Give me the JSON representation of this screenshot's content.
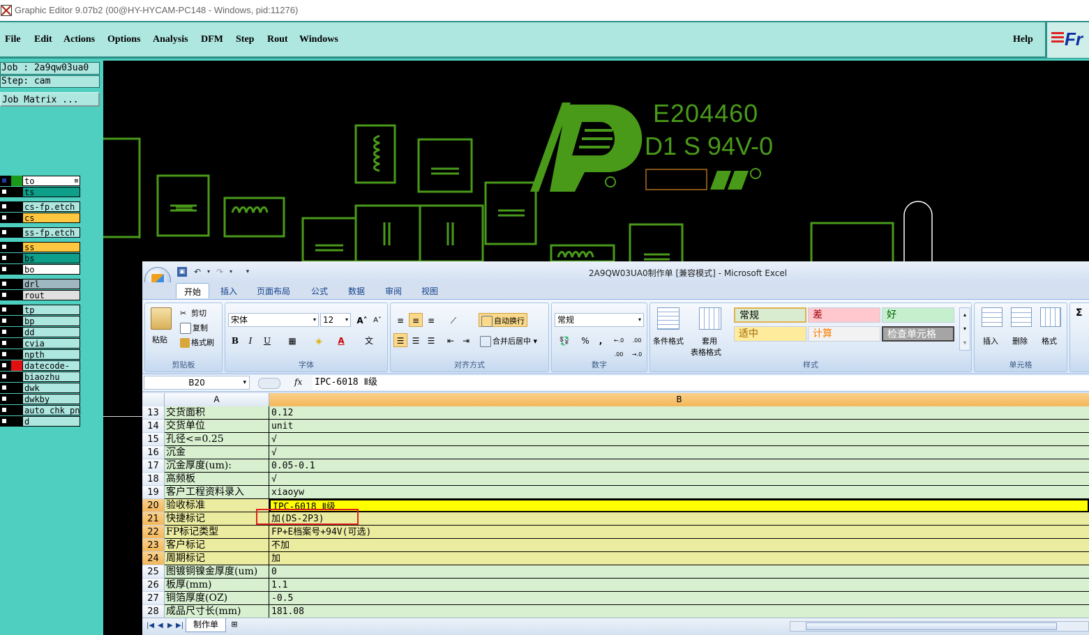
{
  "window": {
    "title": "Graphic Editor 9.07b2 (00@HY-HYCAM-PC148 - Windows, pid:11276)"
  },
  "menu": {
    "items": [
      "File",
      "Edit",
      "Actions",
      "Options",
      "Analysis",
      "DFM",
      "Step",
      "Rout",
      "Windows"
    ],
    "help": "Help",
    "logo": "Fr"
  },
  "left_panel": {
    "job": "Job : 2a9qw03ua0",
    "step": "Step: cam",
    "job_matrix": "Job Matrix ...",
    "layers": [
      {
        "name": "to",
        "color": "#ffffff",
        "swatch": "#1a9a1a",
        "marker": "⊠"
      },
      {
        "name": "ts",
        "color": "#0e9f8a",
        "swatch": "#000000"
      },
      {
        "name": "cs-fp.etch",
        "color": "#aee6e0",
        "swatch": "#000000"
      },
      {
        "name": "cs",
        "color": "#ffc640",
        "swatch": "#000000"
      },
      {
        "name": "ss-fp.etch",
        "color": "#aee6e0",
        "swatch": "#000000"
      },
      {
        "name": "ss",
        "color": "#ffc640",
        "swatch": "#000000"
      },
      {
        "name": "bs",
        "color": "#0e9f8a",
        "swatch": "#000000"
      },
      {
        "name": "bo",
        "color": "#ffffff",
        "swatch": "#000000"
      },
      {
        "name": "drl",
        "color": "#9fb7c0",
        "swatch": "#000000"
      },
      {
        "name": "rout",
        "color": "#e0e0e0",
        "swatch": "#000000"
      },
      {
        "name": "tp",
        "color": "#aee6e0",
        "swatch": "#000000"
      },
      {
        "name": "bp",
        "color": "#aee6e0",
        "swatch": "#000000"
      },
      {
        "name": "dd",
        "color": "#aee6e0",
        "swatch": "#000000"
      },
      {
        "name": "cvia",
        "color": "#aee6e0",
        "swatch": "#000000"
      },
      {
        "name": "npth",
        "color": "#aee6e0",
        "swatch": "#000000"
      },
      {
        "name": "datecode-to",
        "color": "#aee6e0",
        "swatch": "#e01010"
      },
      {
        "name": "biaozhu",
        "color": "#aee6e0",
        "swatch": "#000000"
      },
      {
        "name": "dwk",
        "color": "#aee6e0",
        "swatch": "#000000"
      },
      {
        "name": "dwkby",
        "color": "#aee6e0",
        "swatch": "#000000"
      },
      {
        "name": "auto_chk_pn",
        "color": "#aee6e0",
        "swatch": "#000000"
      },
      {
        "name": "d",
        "color": "#aee6e0",
        "swatch": "#000000"
      }
    ]
  },
  "canvas": {
    "marking_line1": "E204460",
    "marking_line2": "D1 S 94V-0",
    "ul_mark": "Ⓡ",
    "trace_color": "#4a9a1a"
  },
  "excel": {
    "title": "2A9QW03UA0制作单  [兼容模式] - Microsoft Excel",
    "qat_dropdown": "▾",
    "tabs": [
      "开始",
      "插入",
      "页面布局",
      "公式",
      "数据",
      "审阅",
      "视图"
    ],
    "ribbon": {
      "clipboard": {
        "label": "剪贴板",
        "paste": "粘贴",
        "cut": "剪切",
        "copy": "复制",
        "format_painter": "格式刷"
      },
      "font": {
        "label": "字体",
        "name": "宋体",
        "size": "12",
        "grow": "A˄",
        "shrink": "A˅",
        "bold": "B",
        "italic": "I",
        "underline": "U",
        "font_color": "A",
        "phonetic": "文"
      },
      "alignment": {
        "label": "对齐方式",
        "wrap": "自动换行",
        "merge": "合并后居中"
      },
      "number": {
        "label": "数字",
        "format": "常规",
        "percent": "%",
        "comma": ",",
        "inc_decimal": "←.0 .00",
        "dec_decimal": ".00 →.0"
      },
      "styles": {
        "label": "样式",
        "conditional": "条件格式",
        "table_line1": "套用",
        "table_line2": "表格格式",
        "cells": [
          {
            "text": "常规",
            "bg": "#d9ecd0",
            "fg": "#000000"
          },
          {
            "text": "差",
            "bg": "#ffc7ce",
            "fg": "#9c0006"
          },
          {
            "text": "好",
            "bg": "#c6efce",
            "fg": "#006100"
          },
          {
            "text": "适中",
            "bg": "#ffeb9c",
            "fg": "#9c6500"
          },
          {
            "text": "计算",
            "bg": "#f2f2f2",
            "fg": "#fa7d00"
          },
          {
            "text": "检查单元格",
            "bg": "#a5a5a5",
            "fg": "#ffffff"
          }
        ]
      },
      "cells_group": {
        "label": "单元格",
        "insert": "插入",
        "delete": "删除",
        "format": "格式"
      },
      "edit_partial": "Σ"
    },
    "name_box": "B20",
    "fx": "fx",
    "formula": "IPC-6018 Ⅱ级",
    "col_a": "A",
    "col_b": "B",
    "rows": [
      {
        "n": "13",
        "a": "交货面积",
        "b": "0.12",
        "style": "normal"
      },
      {
        "n": "14",
        "a": "交货单位",
        "b": "unit",
        "style": "normal"
      },
      {
        "n": "15",
        "a": "孔径<=0.25",
        "b": "√",
        "style": "normal"
      },
      {
        "n": "16",
        "a": "沉金",
        "b": "√",
        "style": "normal"
      },
      {
        "n": "17",
        "a": "沉金厚度(um):",
        "b": "0.05-0.1",
        "style": "normal"
      },
      {
        "n": "18",
        "a": "高频板",
        "b": "√",
        "style": "normal"
      },
      {
        "n": "19",
        "a": "客户工程资料录入",
        "b": "xiaoyw",
        "style": "normal"
      },
      {
        "n": "20",
        "a": "验收标准",
        "b": "IPC-6018 Ⅱ级",
        "style": "selected"
      },
      {
        "n": "21",
        "a": "快捷标记",
        "b": "加(DS-2P3)",
        "style": "yellow"
      },
      {
        "n": "22",
        "a": "FP标记类型",
        "b": "FP+E档案号+94V(可选)",
        "style": "yellow"
      },
      {
        "n": "23",
        "a": "客户标记",
        "b": "不加",
        "style": "yellow"
      },
      {
        "n": "24",
        "a": "周期标记",
        "b": "加",
        "style": "yellow"
      },
      {
        "n": "25",
        "a": "图镀铜镍金厚度(um)",
        "b": "0",
        "style": "normal"
      },
      {
        "n": "26",
        "a": "板厚(mm)",
        "b": "1.1",
        "style": "normal"
      },
      {
        "n": "27",
        "a": "铜箔厚度(OZ)",
        "b": "-0.5",
        "style": "normal"
      },
      {
        "n": "28",
        "a": "成品尺寸长(mm)",
        "b": "181.08",
        "style": "normal"
      }
    ],
    "sheet_tab": "制作单"
  }
}
